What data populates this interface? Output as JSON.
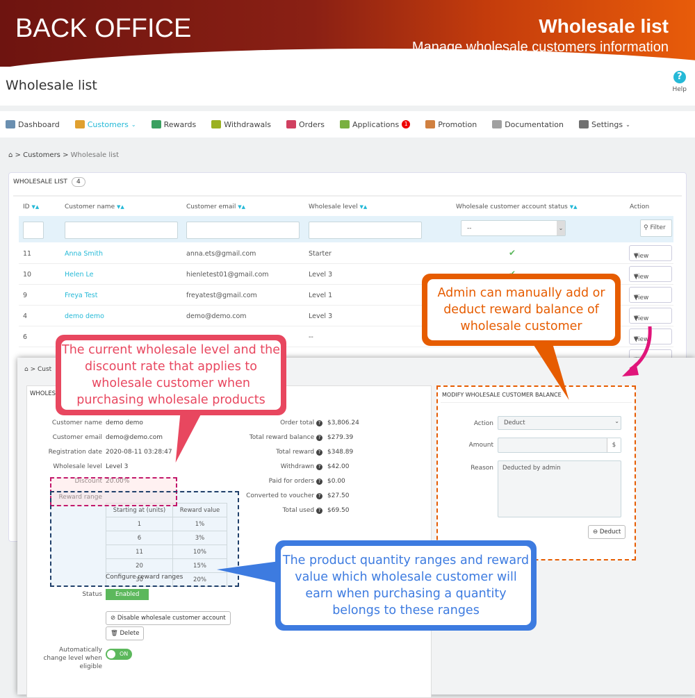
{
  "banner": {
    "left_title": "BACK OFFICE",
    "right_title": "Wholesale list",
    "right_subtitle": "Manage wholesale customers information"
  },
  "page": {
    "title": "Wholesale list",
    "help": "Help"
  },
  "nav": [
    {
      "label": "Dashboard",
      "color": "#6a8fb0"
    },
    {
      "label": "Customers",
      "color": "#e0a030",
      "active": true
    },
    {
      "label": "Rewards",
      "color": "#3aa060"
    },
    {
      "label": "Withdrawals",
      "color": "#9ab020"
    },
    {
      "label": "Orders",
      "color": "#d04060"
    },
    {
      "label": "Applications",
      "color": "#7ab040",
      "badge": "1"
    },
    {
      "label": "Promotion",
      "color": "#d08040"
    },
    {
      "label": "Documentation",
      "color": "#a0a0a0"
    },
    {
      "label": "Settings",
      "color": "#707070"
    }
  ],
  "breadcrumb": [
    "Customers",
    "Wholesale list"
  ],
  "list": {
    "title": "WHOLESALE LIST",
    "count": "4",
    "columns": [
      "ID",
      "Customer name",
      "Customer email",
      "Wholesale level",
      "Wholesale customer account status",
      "Action"
    ],
    "status_select": "--",
    "filter": "Filter",
    "view": "View",
    "rows": [
      {
        "id": "11",
        "name": "Anna Smith",
        "email": "anna.ets@gmail.com",
        "level": "Starter"
      },
      {
        "id": "10",
        "name": "Helen Le",
        "email": "hienletest01@gmail.com",
        "level": "Level 3"
      },
      {
        "id": "9",
        "name": "Freya Test",
        "email": "freyatest@gmail.com",
        "level": "Level 1"
      },
      {
        "id": "4",
        "name": "demo demo",
        "email": "demo@demo.com",
        "level": "Level 3"
      },
      {
        "id": "6",
        "name": "",
        "email": "",
        "level": "--"
      }
    ]
  },
  "detail": {
    "crumb": "Cust",
    "card_title": "WHOLESA",
    "fields": [
      {
        "label": "Customer name",
        "value": "demo demo"
      },
      {
        "label": "Customer email",
        "value": "demo@demo.com"
      },
      {
        "label": "Registration date",
        "value": "2020-08-11 03:28:47"
      },
      {
        "label": "Wholesale level",
        "value": "Level 3"
      },
      {
        "label": "Discount",
        "value": "20.00%"
      }
    ],
    "reward_range_label": "Reward range",
    "range_headers": [
      "Starting at (units)",
      "Reward value"
    ],
    "ranges": [
      [
        "1",
        "1%"
      ],
      [
        "6",
        "3%"
      ],
      [
        "11",
        "10%"
      ],
      [
        "20",
        "15%"
      ],
      [
        "30",
        "20%"
      ]
    ],
    "configure": "Configure reward ranges",
    "status_label": "Status",
    "status": "Enabled",
    "disable_btn": "Disable wholesale customer account",
    "delete_btn": "Delete",
    "auto_label": "Automatically change level when eligible",
    "auto_toggle": "ON",
    "stats": [
      {
        "label": "Order total",
        "value": "$3,806.24"
      },
      {
        "label": "Total reward balance",
        "value": "$279.39"
      },
      {
        "label": "Total reward",
        "value": "$348.89"
      },
      {
        "label": "Withdrawn",
        "value": "$42.00"
      },
      {
        "label": "Paid for orders",
        "value": "$0.00"
      },
      {
        "label": "Converted to voucher",
        "value": "$27.50"
      },
      {
        "label": "Total used",
        "value": "$69.50"
      }
    ]
  },
  "balance": {
    "title": "MODIFY WHOLESALE CUSTOMER BALANCE",
    "action_label": "Action",
    "action": "Deduct",
    "amount_label": "Amount",
    "currency": "$",
    "reason_label": "Reason",
    "reason": "Deducted by admin",
    "button": "Deduct"
  },
  "callouts": {
    "pink": "The current wholesale level and the discount rate that applies to wholesale customer when purchasing wholesale products",
    "orange": "Admin can manually add or deduct reward balance of wholesale customer",
    "blue": "The product quantity ranges and reward value which wholesale customer will earn when purchasing a quantity belongs to these ranges"
  },
  "colors": {
    "pink": "#e8475f",
    "orange": "#e65c00",
    "blue": "#3d7be0",
    "accent": "#25b9d7"
  }
}
